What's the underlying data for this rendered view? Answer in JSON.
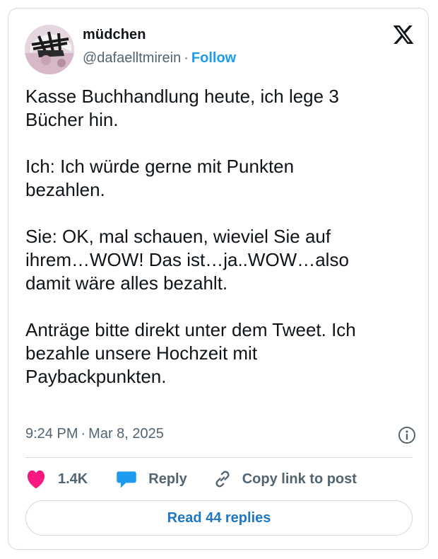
{
  "author": {
    "name": "müdchen",
    "handle": "@dafaelltmirein",
    "separator": "·",
    "follow_label": "Follow",
    "avatar_icon": "profile-photo"
  },
  "logo": {
    "icon": "x-logo-icon"
  },
  "post": {
    "paragraphs": [
      "Kasse Buchhandlung heute, ich lege 3\nBücher hin.",
      "Ich: Ich würde gerne mit Punkten\nbezahlen.",
      "Sie: OK, mal schauen, wieviel Sie auf\nihrem…WOW! Das ist…ja..WOW…also\ndamit wäre alles bezahlt.",
      "Anträge bitte direkt unter dem Tweet. Ich\nbezahle unsere Hochzeit mit\nPaybackpunkten."
    ],
    "time": "9:24 PM",
    "separator": "·",
    "date": "Mar 8, 2025",
    "info_icon": "info-icon"
  },
  "actions": {
    "like_count": "1.4K",
    "reply_label": "Reply",
    "copy_link_label": "Copy link to post",
    "like_color": "#f91880",
    "reply_color": "#1d9bf0"
  },
  "footer": {
    "read_replies_label": "Read 44 replies"
  }
}
